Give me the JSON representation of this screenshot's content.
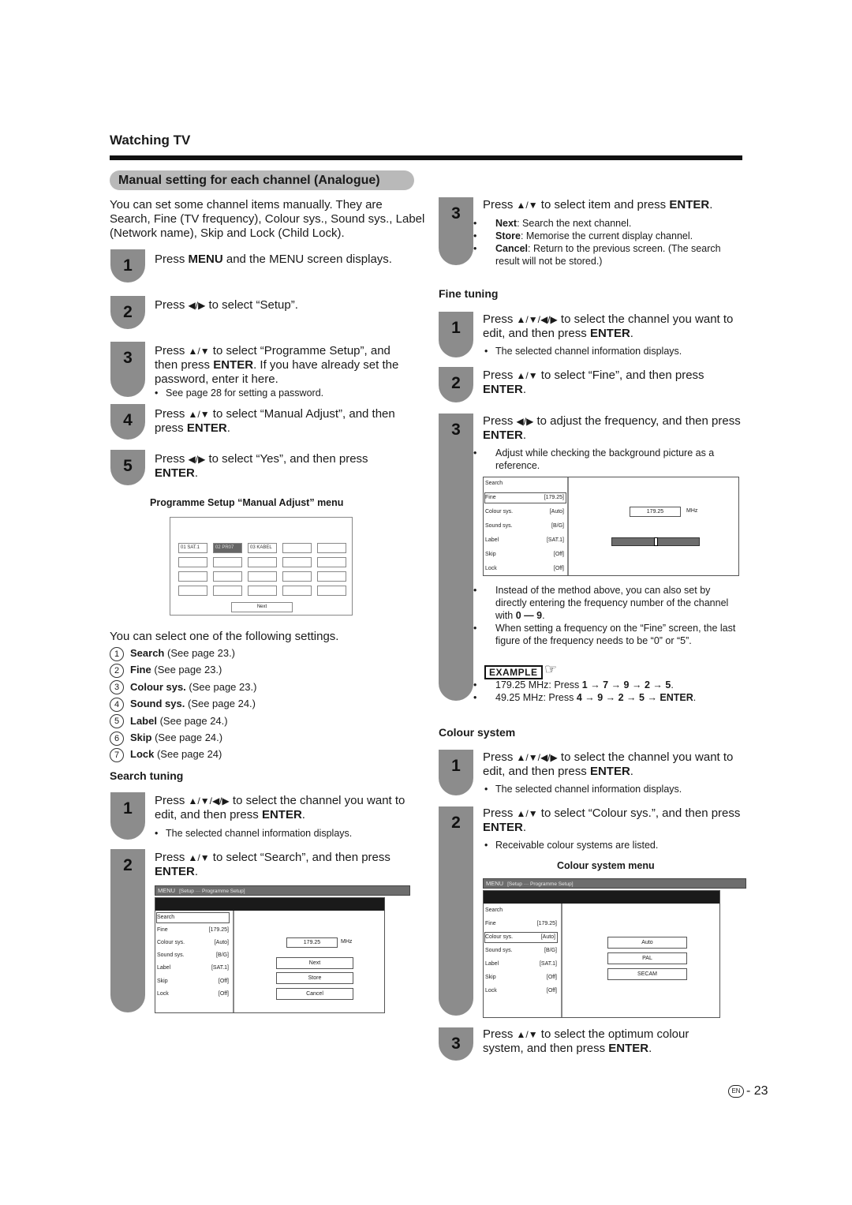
{
  "header": {
    "section": "Watching TV",
    "title": "Manual setting for each channel (Analogue)",
    "intro": "You can set some channel items manually. They are Search, Fine (TV frequency), Colour sys., Sound sys., Label (Network name), Skip and Lock (Child Lock)."
  },
  "icons": {
    "up": "▲",
    "down": "▼",
    "left": "◀",
    "right": "▶",
    "bullet": "•",
    "arrow": "→",
    "hand": "☞"
  },
  "main_steps": [
    {
      "num": "1",
      "pre": "Press ",
      "bold": "MENU",
      "post": " and the MENU screen displays."
    },
    {
      "num": "2",
      "pre": "Press ",
      "keys": "◀/▶",
      "post": " to select “Setup”."
    },
    {
      "num": "3",
      "pre": "Press ",
      "keys": "▲/▼",
      "post": " to select “Programme Setup”, and then press ",
      "bold": "ENTER",
      "post2": ". If you have already set the password, enter it here.",
      "note": "See page 28 for setting a password."
    },
    {
      "num": "4",
      "pre": "Press ",
      "keys": "▲/▼",
      "post": " to select “Manual Adjust”, and then press ",
      "bold": "ENTER",
      "post2": "."
    },
    {
      "num": "5",
      "pre": "Press ",
      "keys": "◀/▶",
      "post": " to select “Yes”, and then press ",
      "bold": "ENTER",
      "post2": "."
    }
  ],
  "manual_adjust_menu": {
    "caption": "Programme Setup “Manual Adjust” menu",
    "channels": [
      "01  SAT.1",
      "02  PR07",
      "03  KABEL"
    ],
    "selected_channel": "02  PR07",
    "next_label": "Next"
  },
  "settings": {
    "intro": "You can select one of the following settings.",
    "items": [
      {
        "num": "1",
        "name": "Search",
        "ref": "(See page 23.)"
      },
      {
        "num": "2",
        "name": "Fine",
        "ref": "(See page 23.)"
      },
      {
        "num": "3",
        "name": "Colour sys.",
        "ref": "(See page 23.)"
      },
      {
        "num": "4",
        "name": "Sound sys.",
        "ref": "(See page 24.)"
      },
      {
        "num": "5",
        "name": "Label",
        "ref": "(See page 24.)"
      },
      {
        "num": "6",
        "name": "Skip",
        "ref": "(See page 24.)"
      },
      {
        "num": "7",
        "name": "Lock",
        "ref": "(See page 24)"
      }
    ]
  },
  "search_tuning": {
    "heading": "Search tuning",
    "step1": {
      "num": "1",
      "pre": "Press ",
      "keys": "▲/▼/◀/▶",
      "post": " to select the channel you want to edit, and then press ",
      "bold": "ENTER",
      "post2": ".",
      "note": "The selected channel information displays."
    },
    "step2": {
      "num": "2",
      "pre": "Press ",
      "keys": "▲/▼",
      "post": " to select “Search”, and then press ",
      "bold": "ENTER",
      "post2": "."
    },
    "step3": {
      "num": "3",
      "pre": "Press ",
      "keys": "▲/▼",
      "post": " to select item and press ",
      "bold": "ENTER",
      "post2": ".",
      "bullets": [
        {
          "bold": "Next",
          "text": ": Search the next channel."
        },
        {
          "bold": "Store",
          "text": ": Memorise the current display channel."
        },
        {
          "bold": "Cancel",
          "text": ": Return to the previous screen. (The search result will not be stored.)"
        }
      ]
    }
  },
  "tv_menu": {
    "menu_label": "MENU",
    "path": "[Setup ··· Programme Setup]",
    "rows": [
      {
        "label": "Search",
        "value": ""
      },
      {
        "label": "Fine",
        "value": "[179.25]"
      },
      {
        "label": "Colour sys.",
        "value": "[Auto]"
      },
      {
        "label": "Sound sys.",
        "value": "[B/G]"
      },
      {
        "label": "Label",
        "value": "[SAT.1]"
      },
      {
        "label": "Skip",
        "value": "[Off]"
      },
      {
        "label": "Lock",
        "value": "[Off]"
      }
    ],
    "frequency": "179.25",
    "unit": "MHz",
    "search_buttons": [
      "Next",
      "Store",
      "Cancel"
    ],
    "colour_options": [
      "Auto",
      "PAL",
      "SECAM"
    ],
    "fine_slider_position": 0.5
  },
  "fine_tuning": {
    "heading": "Fine tuning",
    "step1": {
      "num": "1",
      "pre": "Press ",
      "keys": "▲/▼/◀/▶",
      "post": " to select the channel you want to edit, and then press ",
      "bold": "ENTER",
      "post2": ".",
      "note": "The selected channel information displays."
    },
    "step2": {
      "num": "2",
      "pre": "Press ",
      "keys": "▲/▼",
      "post": " to select “Fine”, and then press ",
      "bold": "ENTER",
      "post2": "."
    },
    "step3": {
      "num": "3",
      "pre": "Press ",
      "keys": "◀/▶",
      "post": " to adjust the frequency, and then press ",
      "bold": "ENTER",
      "post2": ".",
      "note": "Adjust while checking the background picture as a reference."
    },
    "bullets": [
      {
        "text": "Instead of the method above, you can also set by directly entering the frequency number of the channel with ",
        "bold": "0 — 9",
        "after": "."
      },
      {
        "text": "When setting a frequency on the “Fine” screen, the last figure of the frequency needs to be “0” or “5”.",
        "bold": "",
        "after": ""
      }
    ],
    "example_label": "EXAMPLE",
    "examples": [
      {
        "text": "179.25 MHz: Press ",
        "seq": "1 → 7 → 9 → 2 → 5",
        "after": "."
      },
      {
        "text": "49.25 MHz: Press ",
        "seq": "4 → 9 → 2 → 5 → ENTER",
        "after": "."
      }
    ]
  },
  "colour_system": {
    "heading": "Colour system",
    "step1": {
      "num": "1",
      "pre": "Press ",
      "keys": "▲/▼/◀/▶",
      "post": " to select the channel you want to edit, and then press ",
      "bold": "ENTER",
      "post2": ".",
      "note": "The selected channel information displays."
    },
    "step2": {
      "num": "2",
      "pre": "Press ",
      "keys": "▲/▼",
      "post": " to select “Colour sys.”, and then press ",
      "bold": "ENTER",
      "post2": ".",
      "note": "Receivable colour systems are listed."
    },
    "menu_caption": "Colour system menu",
    "step3": {
      "num": "3",
      "pre": "Press ",
      "keys": "▲/▼",
      "post": " to select the optimum colour system, and then press ",
      "bold": "ENTER",
      "post2": "."
    }
  },
  "footer": {
    "lang": "EN",
    "page": "- 23"
  }
}
